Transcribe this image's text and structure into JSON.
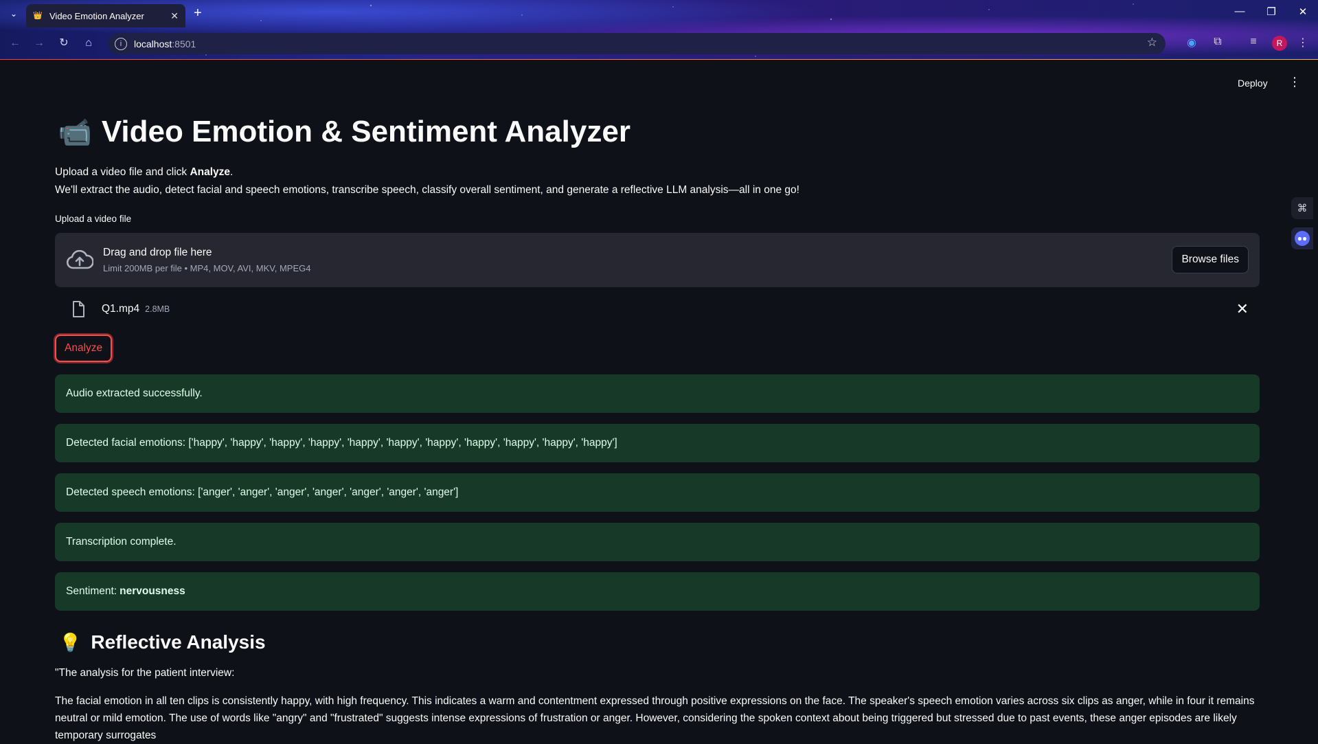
{
  "browser": {
    "tab_title": "Video Emotion Analyzer",
    "url_host": "localhost",
    "url_port": ":8501",
    "profile_initial": "R"
  },
  "header": {
    "deploy_label": "Deploy"
  },
  "app": {
    "title_icon": "📹",
    "title": "Video Emotion & Sentiment Analyzer",
    "intro_line1_prefix": "Upload a video file and click ",
    "intro_line1_bold": "Analyze",
    "intro_line1_suffix": ".",
    "intro_line2": "We'll extract the audio, detect facial and speech emotions, transcribe speech, classify overall sentiment, and generate a reflective LLM analysis—all in one go!"
  },
  "uploader": {
    "label": "Upload a video file",
    "drop_title": "Drag and drop file here",
    "drop_limits": "Limit 200MB per file • MP4, MOV, AVI, MKV, MPEG4",
    "browse_label": "Browse files",
    "file_name": "Q1.mp4",
    "file_size": "2.8MB"
  },
  "analyze_label": "Analyze",
  "alerts": {
    "audio": "Audio extracted successfully.",
    "facial": "Detected facial emotions: ['happy', 'happy', 'happy', 'happy', 'happy', 'happy', 'happy', 'happy', 'happy', 'happy', 'happy']",
    "speech": "Detected speech emotions: ['anger', 'anger', 'anger', 'anger', 'anger', 'anger', 'anger']",
    "transcription": "Transcription complete.",
    "sentiment_prefix": "Sentiment:",
    "sentiment_value": "nervousness"
  },
  "analysis": {
    "icon": "💡",
    "title": "Reflective Analysis",
    "para1": "\"The analysis for the patient interview:",
    "para2": "The facial emotion in all ten clips is consistently happy, with high frequency. This indicates a warm and contentment expressed through positive expressions on the face. The speaker's speech emotion varies across six clips as anger, while in four it remains neutral or mild emotion. The use of words like \"angry\" and \"frustrated\" suggests intense expressions of frustration or anger. However, considering the spoken context about being triggered but stressed due to past events, these anger episodes are likely temporary surrogates"
  },
  "colors": {
    "background": "#0e1117",
    "success_bg": "#173928",
    "accent_red": "#ff4b4b",
    "dropzone_bg": "#262730"
  }
}
